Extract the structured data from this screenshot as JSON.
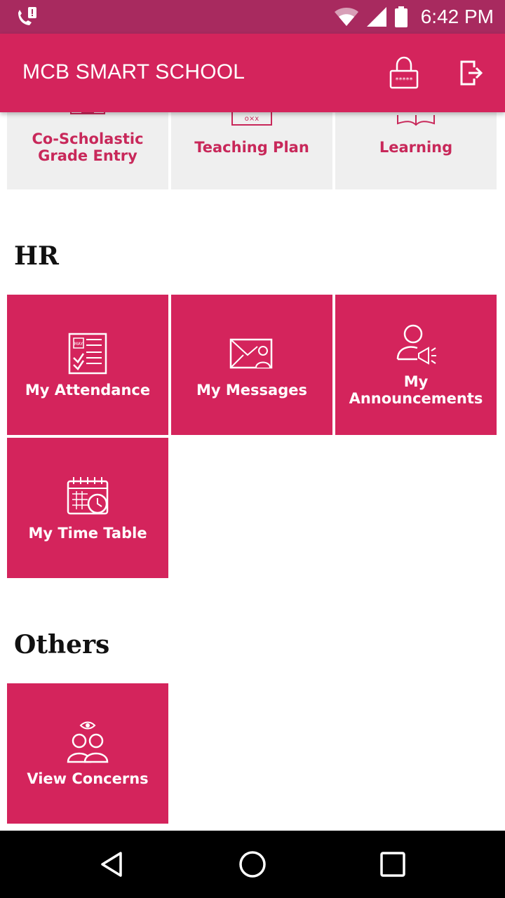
{
  "status_bar": {
    "time": "6:42 PM",
    "icons": [
      "call-alert-icon",
      "wifi-icon",
      "signal-icon",
      "battery-icon"
    ]
  },
  "app_bar": {
    "title": "MCB SMART SCHOOL",
    "icons": [
      "lock-icon",
      "logout-icon"
    ]
  },
  "top_tiles": [
    {
      "label_line1": "Co-Scholastic",
      "label_line2": "Grade Entry",
      "icon": "co-scholastic-icon"
    },
    {
      "label": "Teaching Plan",
      "icon": "teaching-plan-icon"
    },
    {
      "label": "Learning",
      "icon": "learning-icon"
    }
  ],
  "sections": {
    "hr": {
      "title": "HR",
      "tiles": [
        {
          "label": "My Attendance",
          "icon": "attendance-calendar-icon"
        },
        {
          "label": "My Messages",
          "icon": "messages-icon"
        },
        {
          "label_line1": "My",
          "label_line2": "Announcements",
          "icon": "announcements-icon"
        },
        {
          "label": "My Time Table",
          "icon": "timetable-icon"
        }
      ]
    },
    "others": {
      "title": "Others",
      "tiles": [
        {
          "label": "View Concerns",
          "icon": "concerns-icon"
        }
      ]
    }
  },
  "colors": {
    "status_bar": "#a82a5f",
    "app_bar": "#d4245c",
    "tile_pink": "#d4245c",
    "tile_grey": "#efefef",
    "tile_grey_text": "#c8285a"
  },
  "nav_bar": {
    "icons": [
      "back-icon",
      "home-icon",
      "recent-apps-icon"
    ]
  }
}
